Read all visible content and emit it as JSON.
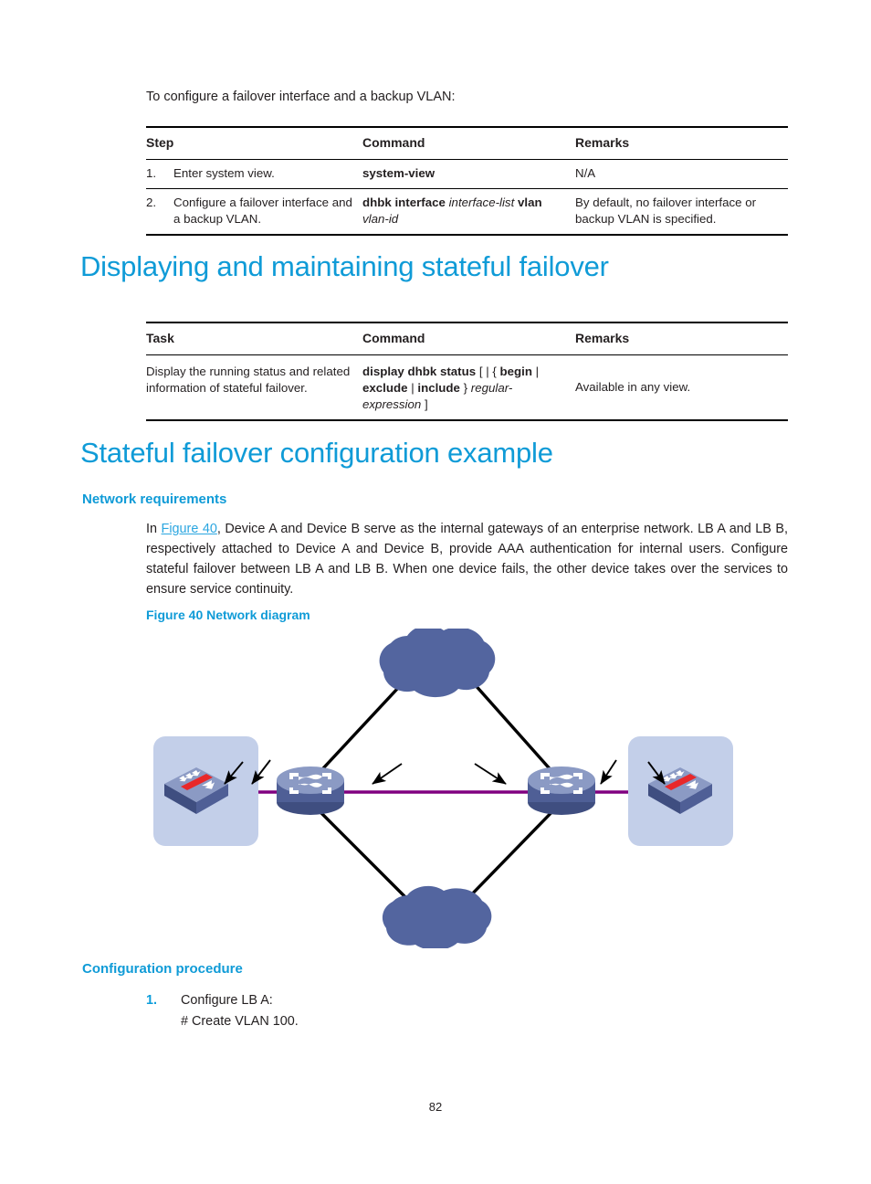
{
  "document": {
    "page_number": "82",
    "intro_text": "To configure a failover interface and a backup VLAN:"
  },
  "table_steps": {
    "headers": [
      "Step",
      "Command",
      "Remarks"
    ],
    "rows": [
      {
        "num": "1.",
        "step": "Enter system view.",
        "command_html": "<b>system-view</b>",
        "remarks": "N/A"
      },
      {
        "num": "2.",
        "step": "Configure a failover interface and a backup VLAN.",
        "command_html": "<b>dhbk interface</b> <i>interface-list</i> <b>vlan</b> <i>vlan-id</i>",
        "remarks": "By default, no failover interface or backup VLAN is specified."
      }
    ]
  },
  "heading_displaying": "Displaying and maintaining stateful failover",
  "table_display": {
    "headers": [
      "Task",
      "Command",
      "Remarks"
    ],
    "rows": [
      {
        "task": "Display the running status and related information of stateful failover.",
        "command_html": "<b>display dhbk status</b> [ | { <b>begin</b> | <b>exclude</b> | <b>include</b> } <i>regular-expression</i> ]",
        "remarks": "Available in any view."
      }
    ]
  },
  "heading_example": "Stateful failover configuration example",
  "network_requirements": {
    "heading": "Network requirements",
    "text_before_link": "In ",
    "link_text": "Figure 40",
    "text_after_link": ", Device A and Device B serve as the internal gateways of an enterprise network. LB A and LB B, respectively attached to Device A and Device B, provide AAA authentication for internal users. Configure stateful failover between LB A and LB B. When one device fails, the other device takes over the services to ensure service continuity."
  },
  "figure": {
    "caption": "Figure 40 Network diagram",
    "nodes": [
      {
        "id": "cloud-top",
        "type": "cloud",
        "role": "external-network"
      },
      {
        "id": "cloud-bottom",
        "type": "cloud",
        "role": "internal-network"
      },
      {
        "id": "switch-left",
        "type": "switch",
        "role": "lb-a"
      },
      {
        "id": "switch-right",
        "type": "switch",
        "role": "lb-b"
      },
      {
        "id": "router-left",
        "type": "router",
        "role": "device-a"
      },
      {
        "id": "router-right",
        "type": "router",
        "role": "device-b"
      }
    ],
    "colors": {
      "cloud": "#53659f",
      "router_body": "#5d6ea6",
      "router_top": "#8fa0c8",
      "switch_top": "#8b9ac4",
      "switch_side": "#4f5f96",
      "panel": "#c3cfe9",
      "link_line": "#000000",
      "heartbeat_line": "#800080",
      "accent_red": "#e8282a"
    }
  },
  "configuration_procedure": {
    "heading": "Configuration procedure",
    "steps": [
      {
        "num": "1.",
        "text": "Configure LB A:",
        "sub": "# Create VLAN 100."
      }
    ]
  }
}
